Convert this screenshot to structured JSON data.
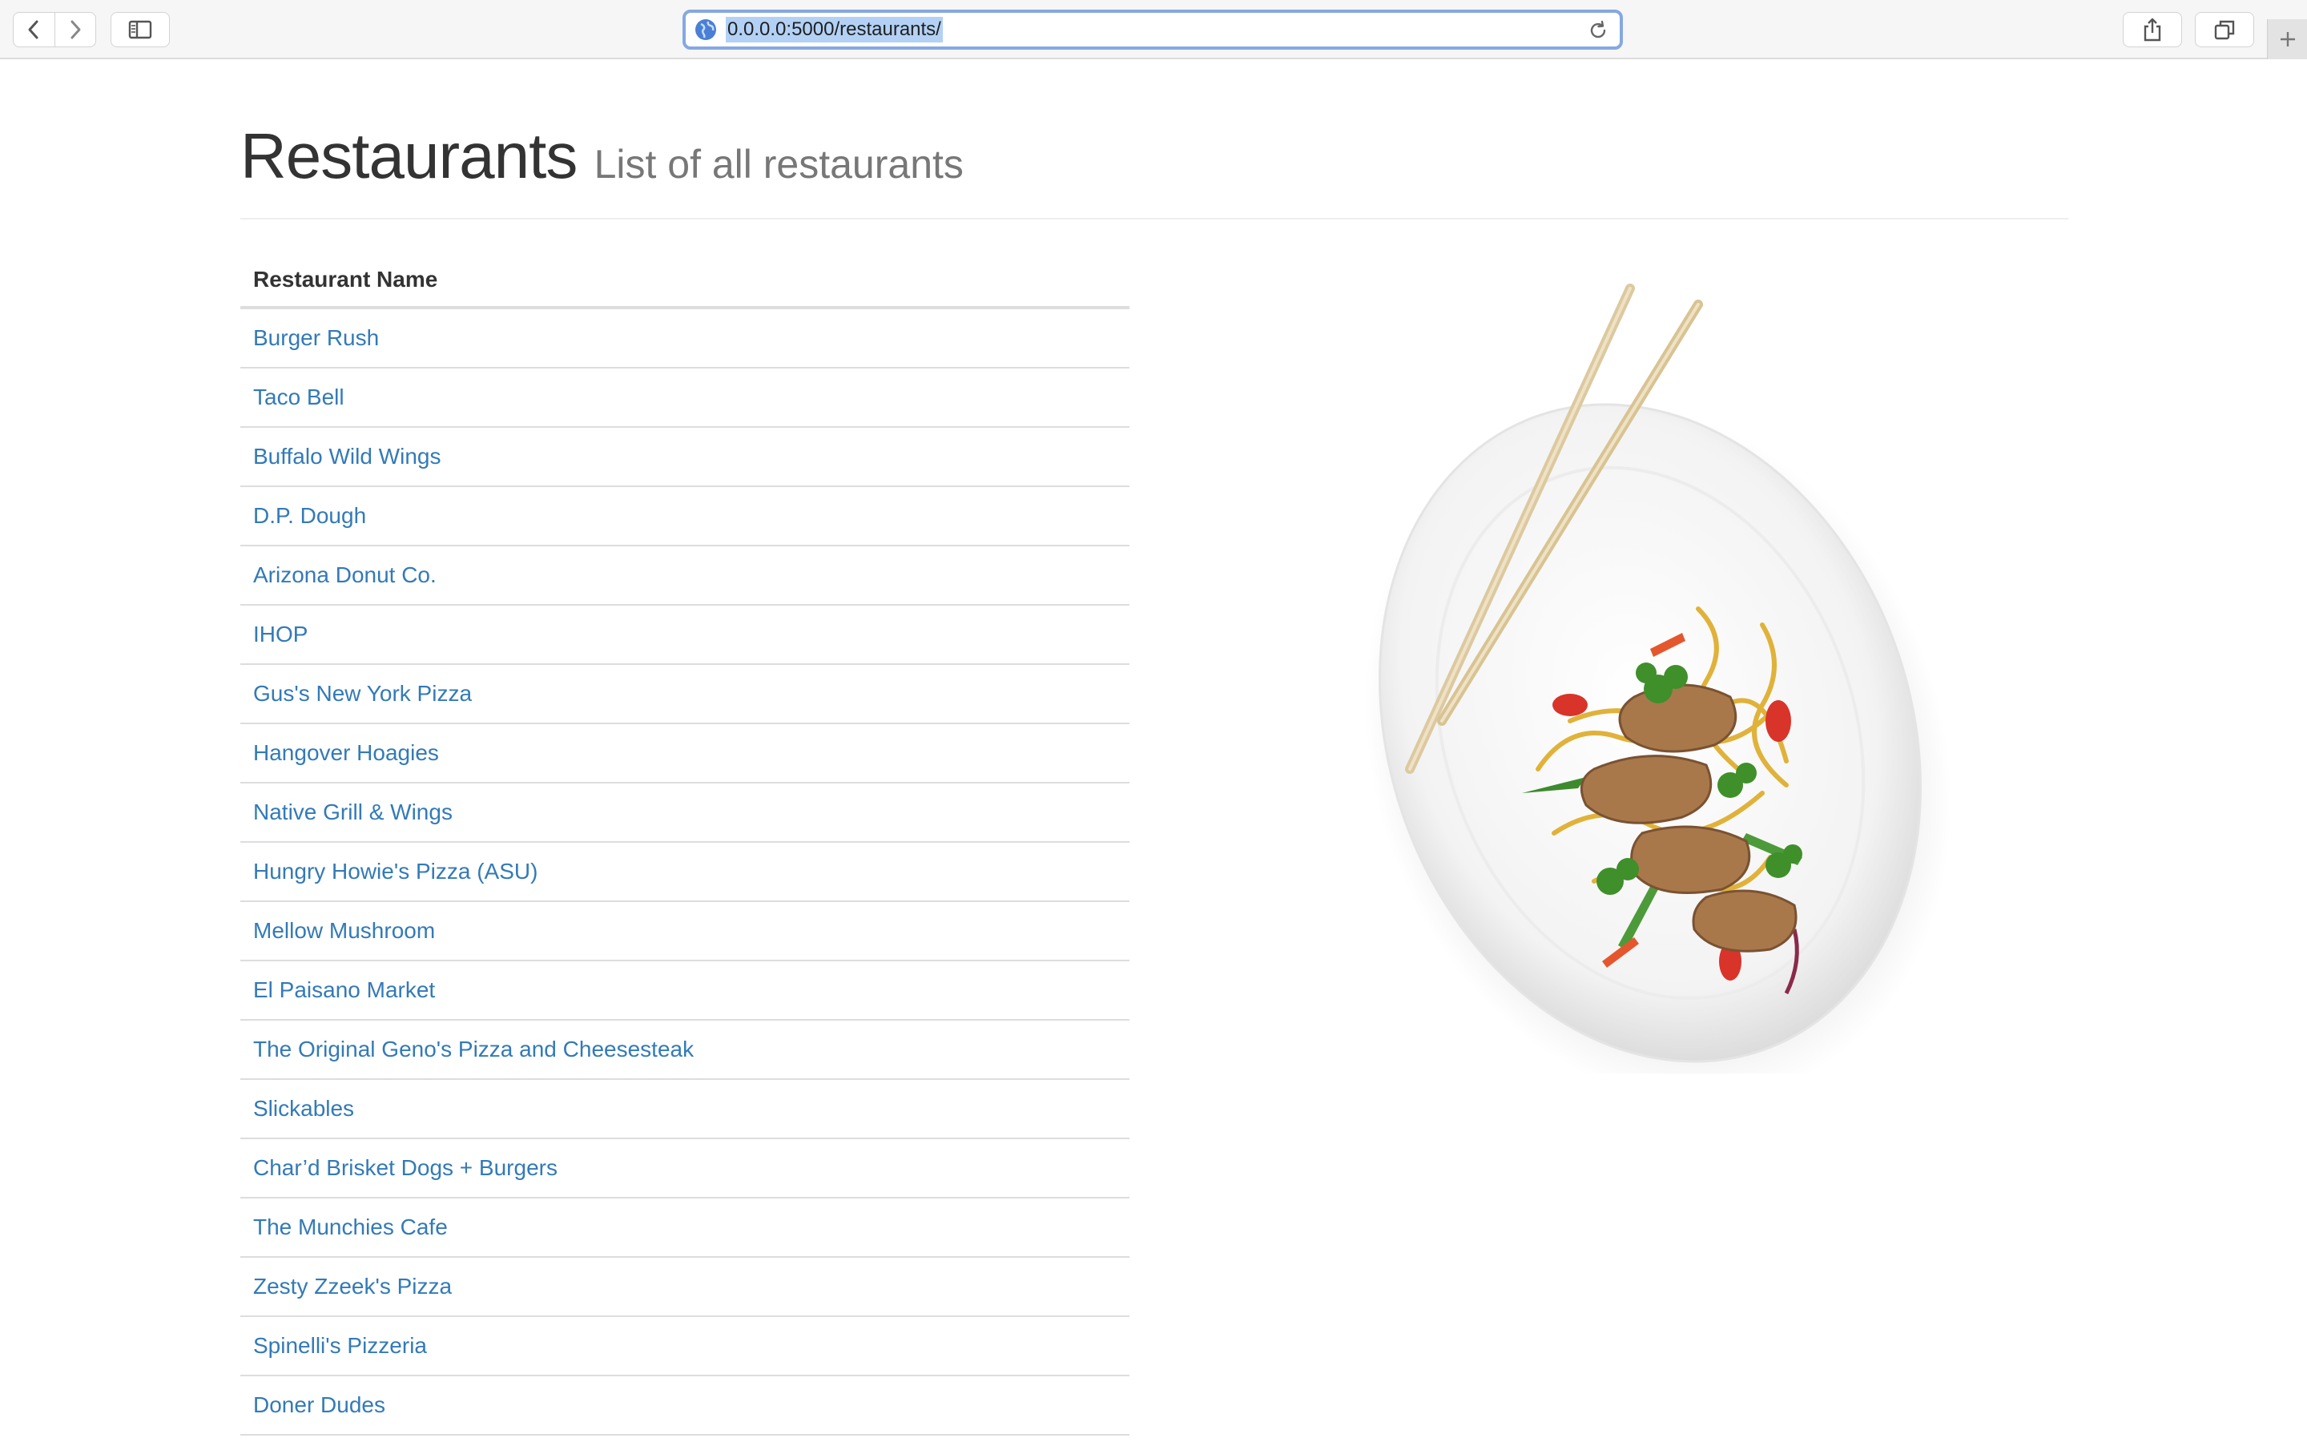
{
  "browser": {
    "url": "0.0.0.0:5000/restaurants/",
    "icons": {
      "back": "chevron-left-icon",
      "forward": "chevron-right-icon",
      "sidebar": "sidebar-icon",
      "site": "globe-icon",
      "reload": "reload-icon",
      "share": "share-icon",
      "tabs": "tabs-overview-icon",
      "new_tab": "plus-icon"
    },
    "accent": "#86a8e0"
  },
  "header": {
    "title": "Restaurants",
    "subtitle": "List of all restaurants"
  },
  "table": {
    "column_header": "Restaurant Name",
    "rows": [
      "Burger Rush",
      "Taco Bell",
      "Buffalo Wild Wings",
      "D.P. Dough",
      "Arizona Donut Co.",
      "IHOP",
      "Gus's New York Pizza",
      "Hangover Hoagies",
      "Native Grill & Wings",
      "Hungry Howie's Pizza (ASU)",
      "Mellow Mushroom",
      "El Paisano Market",
      "The Original Geno's Pizza and Cheesesteak",
      "Slickables",
      "Char’d Brisket Dogs + Burgers",
      "The Munchies Cafe",
      "Zesty Zzeek's Pizza",
      "Spinelli's Pizzeria",
      "Doner Dudes"
    ],
    "link_color": "#337ab7"
  },
  "image": {
    "subject": "noodle-dish-with-chopsticks"
  }
}
